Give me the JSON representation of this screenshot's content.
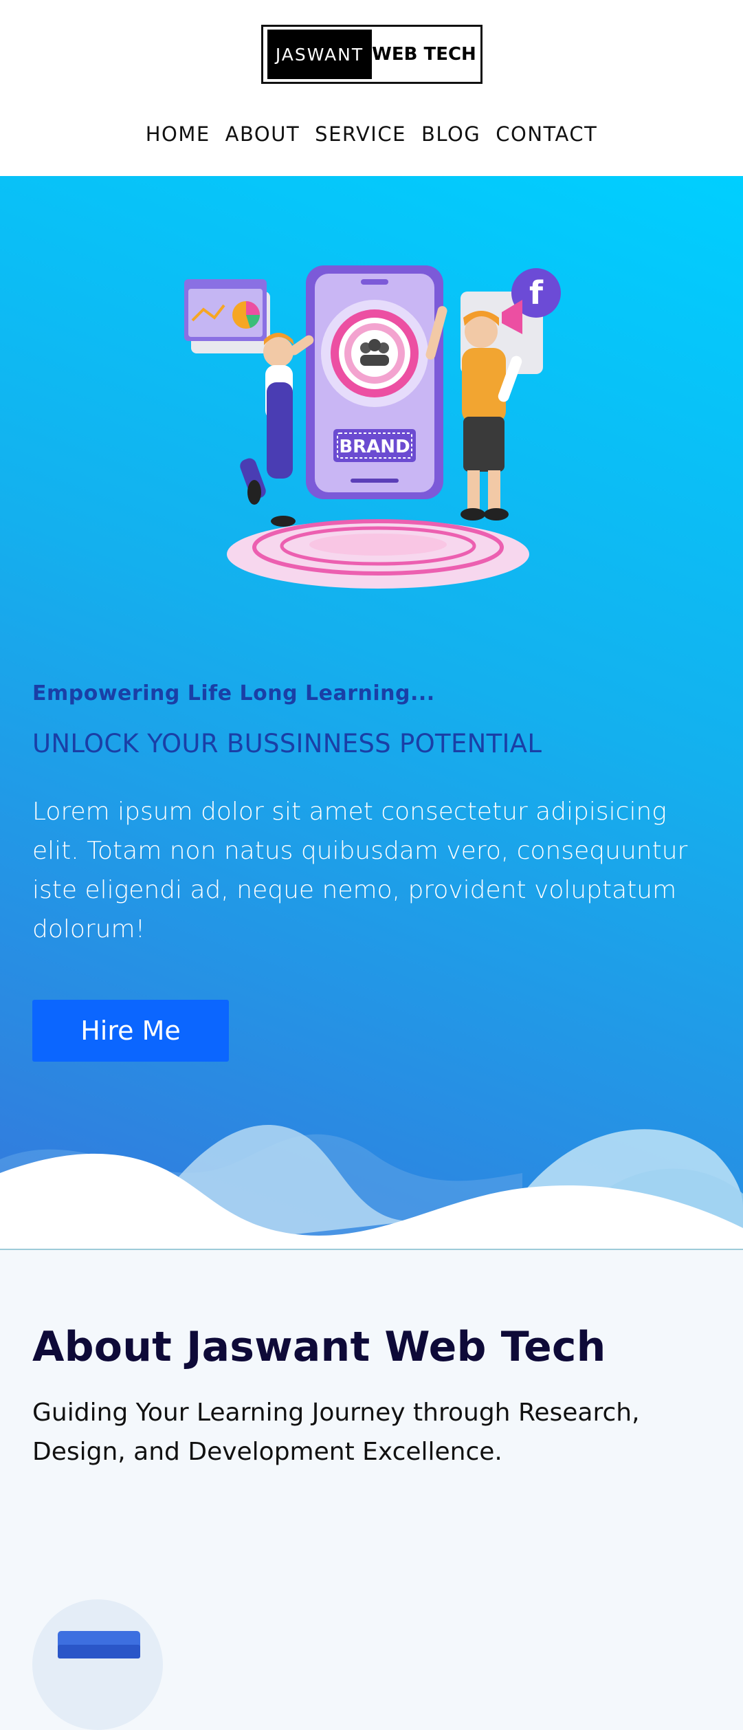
{
  "logo": {
    "left": "JASWANT",
    "right": "WEB TECH"
  },
  "nav": {
    "items": [
      "HOME",
      "ABOUT",
      "SERVICE",
      "BLOG",
      "CONTACT"
    ]
  },
  "hero": {
    "illustration": {
      "badge_text": "BRAND",
      "social_icon": "facebook-icon"
    },
    "tagline": "Empowering Life Long Learning...",
    "headline": "UNLOCK YOUR BUSSINNESS POTENTIAL",
    "paragraph": "Lorem ipsum dolor sit amet consectetur adipisicing elit. Totam non natus quibusdam vero, consequuntur iste eligendi ad, neque nemo, provident voluptatum dolorum!",
    "button_label": "Hire Me"
  },
  "about": {
    "title": "About Jaswant Web Tech",
    "subtitle": "Guiding Your Learning Journey through Research, Design, and Development Excellence."
  },
  "colors": {
    "hero_gradient_top": "#00cfff",
    "hero_gradient_bottom": "#3577dc",
    "tagline_color": "#1a3fa6",
    "button_bg": "#0b66ff",
    "about_title_color": "#0e0a38"
  }
}
